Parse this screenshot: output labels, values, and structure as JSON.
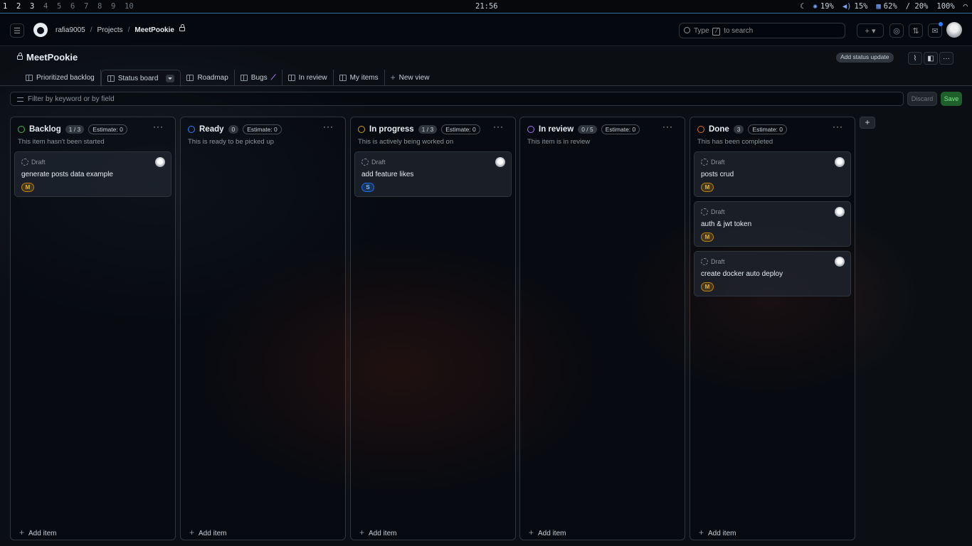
{
  "sysbar": {
    "workspaces": [
      "1",
      "2",
      "3",
      "4",
      "5",
      "6",
      "7",
      "8",
      "9",
      "10"
    ],
    "active_workspaces": [
      "1",
      "2",
      "3"
    ],
    "clock": "21:56",
    "indicators": {
      "cpu": "19%",
      "volume": "15%",
      "memory": "62%",
      "disk": "/ 20%",
      "battery": "100%"
    }
  },
  "header": {
    "breadcrumb": {
      "owner": "rafia9005",
      "section": "Projects",
      "project": "MeetPookie"
    },
    "search_placeholder_pre": "Type",
    "search_key": "/",
    "search_placeholder_post": "to search"
  },
  "project": {
    "title": "MeetPookie",
    "status_update_button": "Add status update"
  },
  "tabs": [
    {
      "label": "Prioritized backlog",
      "icon": "table-icon"
    },
    {
      "label": "Status board",
      "icon": "board-icon"
    },
    {
      "label": "Roadmap",
      "icon": "roadmap-icon"
    },
    {
      "label": "Bugs",
      "icon": "table-icon"
    },
    {
      "label": "In review",
      "icon": "table-icon"
    },
    {
      "label": "My items",
      "icon": "table-icon"
    },
    {
      "label": "New view",
      "icon": "plus-icon"
    }
  ],
  "filter": {
    "placeholder": "Filter by keyword or by field",
    "discard": "Discard",
    "save": "Save"
  },
  "columns": [
    {
      "name": "Backlog",
      "count": "1 / 3",
      "estimate": "Estimate: 0",
      "description": "This item hasn't been started",
      "color": "#3fb950",
      "cards": [
        {
          "status": "Draft",
          "title": "generate posts data example",
          "size": "M"
        }
      ]
    },
    {
      "name": "Ready",
      "count": "0",
      "estimate": "Estimate: 0",
      "description": "This is ready to be picked up",
      "color": "#2f81f7",
      "cards": []
    },
    {
      "name": "In progress",
      "count": "1 / 3",
      "estimate": "Estimate: 0",
      "description": "This is actively being worked on",
      "color": "#d29922",
      "cards": [
        {
          "status": "Draft",
          "title": "add feature likes",
          "size": "S"
        }
      ]
    },
    {
      "name": "In review",
      "count": "0 / 5",
      "estimate": "Estimate: 0",
      "description": "This item is in review",
      "color": "#a371f7",
      "cards": []
    },
    {
      "name": "Done",
      "count": "3",
      "estimate": "Estimate: 0",
      "description": "This has been completed",
      "color": "#db6d28",
      "cards": [
        {
          "status": "Draft",
          "title": "posts crud",
          "size": "M"
        },
        {
          "status": "Draft",
          "title": "auth & jwt token",
          "size": "M"
        },
        {
          "status": "Draft",
          "title": "create docker auto deploy",
          "size": "M"
        }
      ]
    }
  ],
  "add_item_label": "Add item"
}
